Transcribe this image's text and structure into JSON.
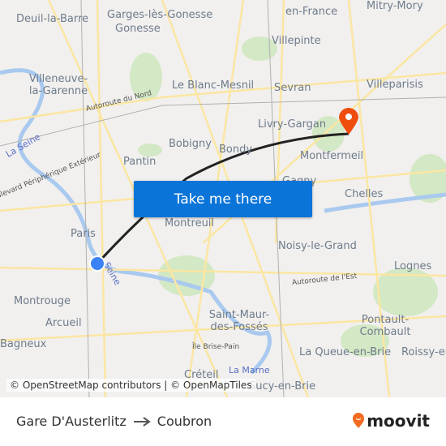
{
  "map": {
    "labels": [
      "Deuil-la-Barre",
      "Garges-lès-Gonesse",
      "Gonesse",
      "en-France",
      "Mitry-Mory",
      "Villepinte",
      "Villeneuve-la-Garenne",
      "Le Blanc-Mesnil",
      "Sevran",
      "Villeparisis",
      "Autoroute du Nord",
      "Livry-Gargan",
      "La Seine",
      "Bobigny",
      "Bondy",
      "Montfermeil",
      "Pantin",
      "Boulevard Périphérique Extérieur",
      "Gagny",
      "Chelles",
      "Paris",
      "Montreuil",
      "Noisy-le-Grand",
      "Lognes",
      "Seine",
      "Autoroute de l'Est",
      "Montrouge",
      "Arcueil",
      "Saint-Maur-des-Fossés",
      "Pontault-Combault",
      "Bagneux",
      "Île Brise-Pain",
      "La Queue-en-Brie",
      "Roissy-en",
      "La Marne",
      "Créteil",
      "Sucy-en-Brie"
    ],
    "cta_label": "Take me there",
    "attribution": "© OpenStreetMap contributors | © OpenMapTiles",
    "origin_color": "#3b82f6",
    "destination_color": "#ee4d0e",
    "route_color": "#222222"
  },
  "footer": {
    "origin": "Gare D'Austerlitz",
    "arrow_icon": "arrow-right-icon",
    "destination": "Coubron",
    "brand": "moovit",
    "brand_color": "#f26b21"
  }
}
